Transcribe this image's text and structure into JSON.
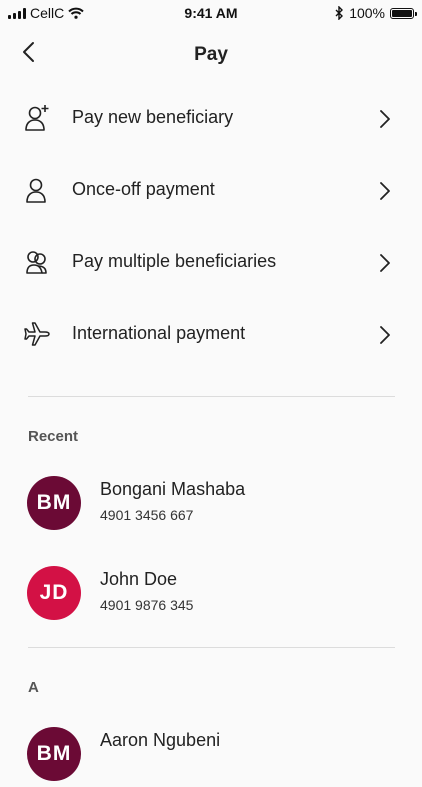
{
  "status_bar": {
    "carrier": "CellC",
    "time": "9:41 AM",
    "battery": "100%"
  },
  "nav": {
    "title": "Pay"
  },
  "menu": [
    {
      "label": "Pay new beneficiary",
      "icon": "add-person-icon"
    },
    {
      "label": "Once-off payment",
      "icon": "person-icon"
    },
    {
      "label": "Pay multiple beneficiaries",
      "icon": "people-icon"
    },
    {
      "label": "International payment",
      "icon": "airplane-icon"
    }
  ],
  "sections": {
    "recent": "Recent",
    "a": "A"
  },
  "recent": [
    {
      "initials": "BM",
      "name": "Bongani Mashaba",
      "account": "4901 3456 667",
      "color": "#6b0a35"
    },
    {
      "initials": "JD",
      "name": "John Doe",
      "account": "4901 9876 345",
      "color": "#d31145"
    }
  ],
  "a_contacts": [
    {
      "initials": "BM",
      "name": "Aaron Ngubeni",
      "color": "#6b0a35"
    }
  ]
}
